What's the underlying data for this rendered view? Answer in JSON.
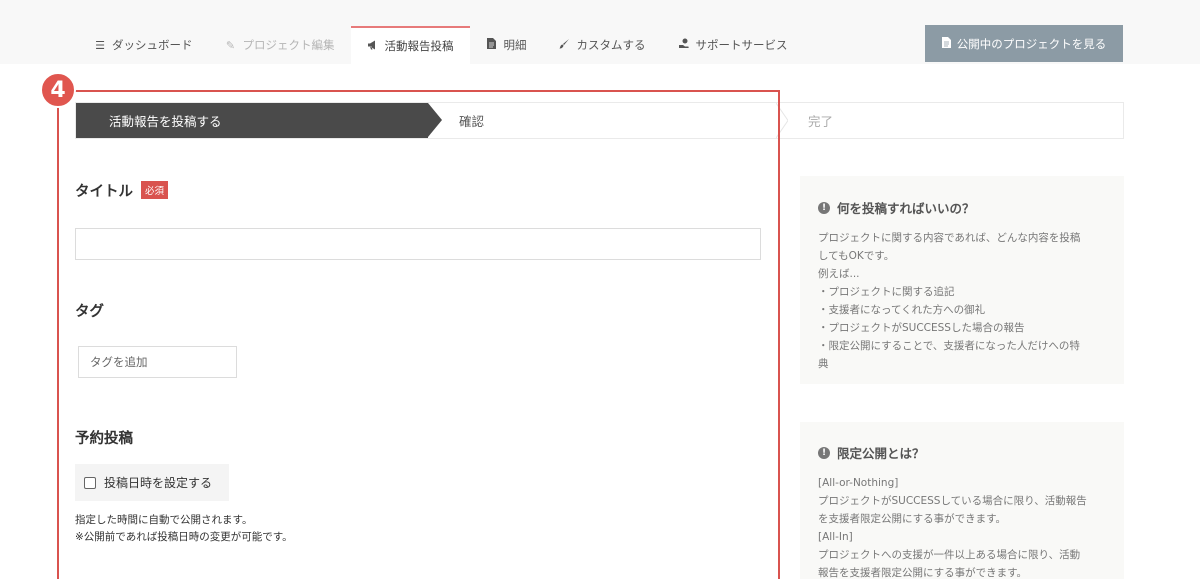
{
  "nav": {
    "tabs": [
      {
        "label": "ダッシュボード",
        "icon": "menu-icon",
        "state": "normal"
      },
      {
        "label": "プロジェクト編集",
        "icon": "pencil-icon",
        "state": "disabled"
      },
      {
        "label": "活動報告投稿",
        "icon": "megaphone-icon",
        "state": "active"
      },
      {
        "label": "明細",
        "icon": "document-icon",
        "state": "normal"
      },
      {
        "label": "カスタムする",
        "icon": "brush-icon",
        "state": "normal"
      },
      {
        "label": "サポートサービス",
        "icon": "handshake-icon",
        "state": "normal"
      }
    ],
    "public_button": "公開中のプロジェクトを見る"
  },
  "steps": {
    "step1": "活動報告を投稿する",
    "step2": "確認",
    "step3": "完了"
  },
  "annotation_number": "4",
  "form": {
    "title_label": "タイトル",
    "required_badge": "必須",
    "tag_label": "タグ",
    "tag_placeholder": "タグを追加",
    "schedule_label": "予約投稿",
    "schedule_checkbox": "投稿日時を設定する",
    "note_line1": "指定した時間に自動で公開されます。",
    "note_line2": "※公開前であれば投稿日時の変更が可能です。"
  },
  "sidebar": {
    "box1": {
      "title": "何を投稿すればいいの？",
      "lines": [
        "プロジェクトに関する内容であれば、どんな内容を投稿",
        "してもOKです。",
        "例えば...",
        "・プロジェクトに関する追記",
        "・支援者になってくれた方への御礼",
        "・プロジェクトがSUCCESSした場合の報告",
        "・限定公開にすることで、支援者になった人だけへの特",
        "典"
      ]
    },
    "box2": {
      "title": "限定公開とは？",
      "lines": [
        "[All-or-Nothing]",
        "プロジェクトがSUCCESSしている場合に限り、活動報告",
        "を支援者限定公開にする事ができます。",
        "[All-In]",
        "プロジェクトへの支援が一件以上ある場合に限り、活動",
        "報告を支援者限定公開にする事ができます。"
      ]
    }
  },
  "colors": {
    "accent_red": "#d9534f",
    "step_active_bg": "#4a4a4a",
    "public_button_bg": "#8c9ba5"
  }
}
